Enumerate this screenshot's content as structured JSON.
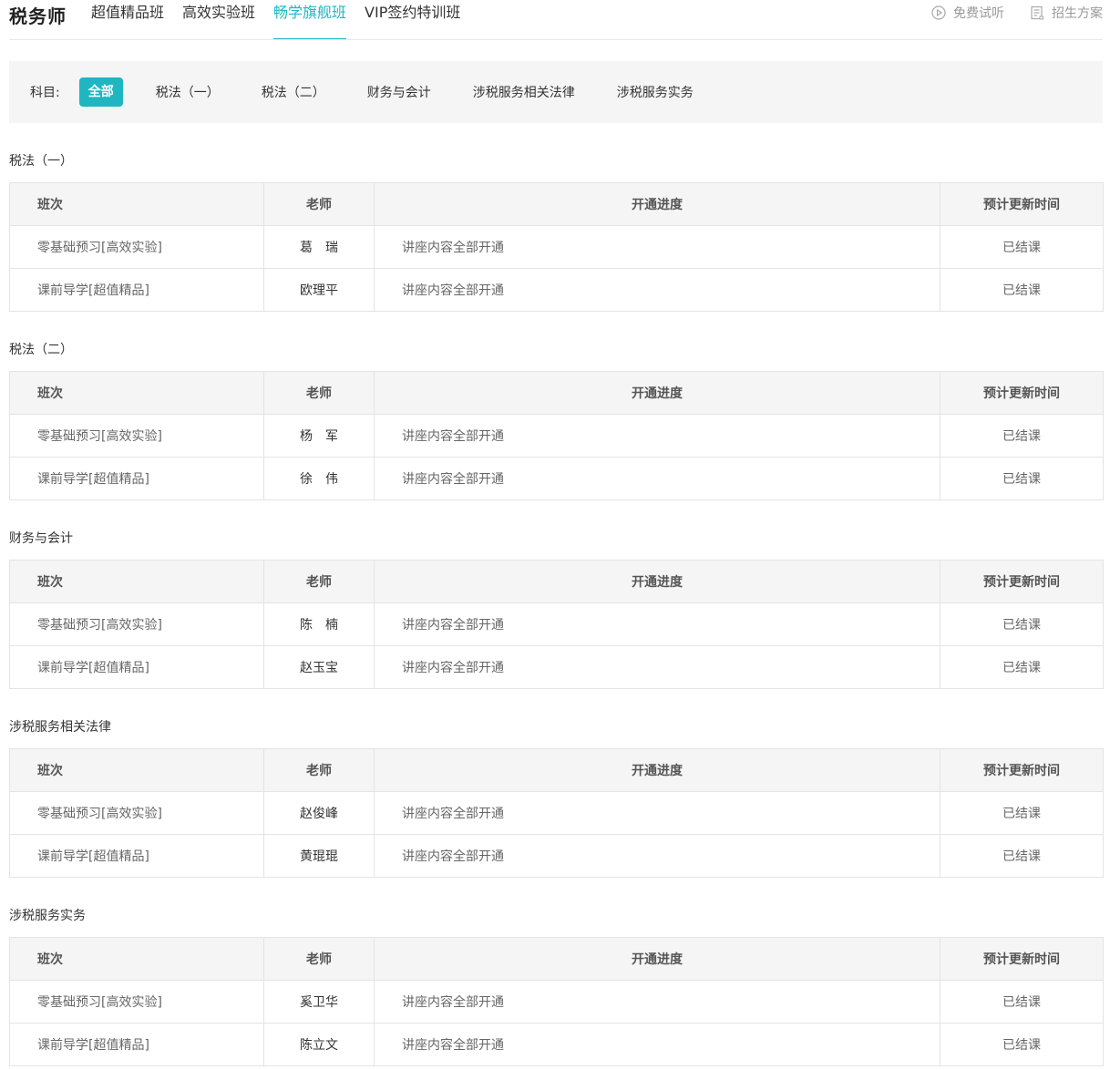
{
  "header": {
    "brand": "税务师",
    "tabs": [
      "超值精品班",
      "高效实验班",
      "畅学旗舰班",
      "VIP签约特训班"
    ],
    "active_tab": 2,
    "links": [
      {
        "label": "免费试听",
        "icon": "play-circle-icon"
      },
      {
        "label": "招生方案",
        "icon": "document-icon"
      }
    ]
  },
  "filter": {
    "label": "科目:",
    "chips": [
      "全部",
      "税法（一）",
      "税法（二）",
      "财务与会计",
      "涉税服务相关法律",
      "涉税服务实务"
    ],
    "active": 0
  },
  "table_headers": [
    "班次",
    "老师",
    "开通进度",
    "预计更新时间"
  ],
  "sections": [
    {
      "title": "税法（一）",
      "rows": [
        [
          "零基础预习[高效实验]",
          "葛　瑞",
          "讲座内容全部开通",
          "已结课"
        ],
        [
          "课前导学[超值精品]",
          "欧理平",
          "讲座内容全部开通",
          "已结课"
        ]
      ]
    },
    {
      "title": "税法（二）",
      "rows": [
        [
          "零基础预习[高效实验]",
          "杨　军",
          "讲座内容全部开通",
          "已结课"
        ],
        [
          "课前导学[超值精品]",
          "徐　伟",
          "讲座内容全部开通",
          "已结课"
        ]
      ]
    },
    {
      "title": "财务与会计",
      "rows": [
        [
          "零基础预习[高效实验]",
          "陈　楠",
          "讲座内容全部开通",
          "已结课"
        ],
        [
          "课前导学[超值精品]",
          "赵玉宝",
          "讲座内容全部开通",
          "已结课"
        ]
      ]
    },
    {
      "title": "涉税服务相关法律",
      "rows": [
        [
          "零基础预习[高效实验]",
          "赵俊峰",
          "讲座内容全部开通",
          "已结课"
        ],
        [
          "课前导学[超值精品]",
          "黄琨琨",
          "讲座内容全部开通",
          "已结课"
        ]
      ]
    },
    {
      "title": "涉税服务实务",
      "rows": [
        [
          "零基础预习[高效实验]",
          "奚卫华",
          "讲座内容全部开通",
          "已结课"
        ],
        [
          "课前导学[超值精品]",
          "陈立文",
          "讲座内容全部开通",
          "已结课"
        ]
      ]
    }
  ],
  "colors": {
    "accent": "#1fb6c2",
    "header_bg": "#f5f5f5",
    "border": "#e4e4e4"
  }
}
